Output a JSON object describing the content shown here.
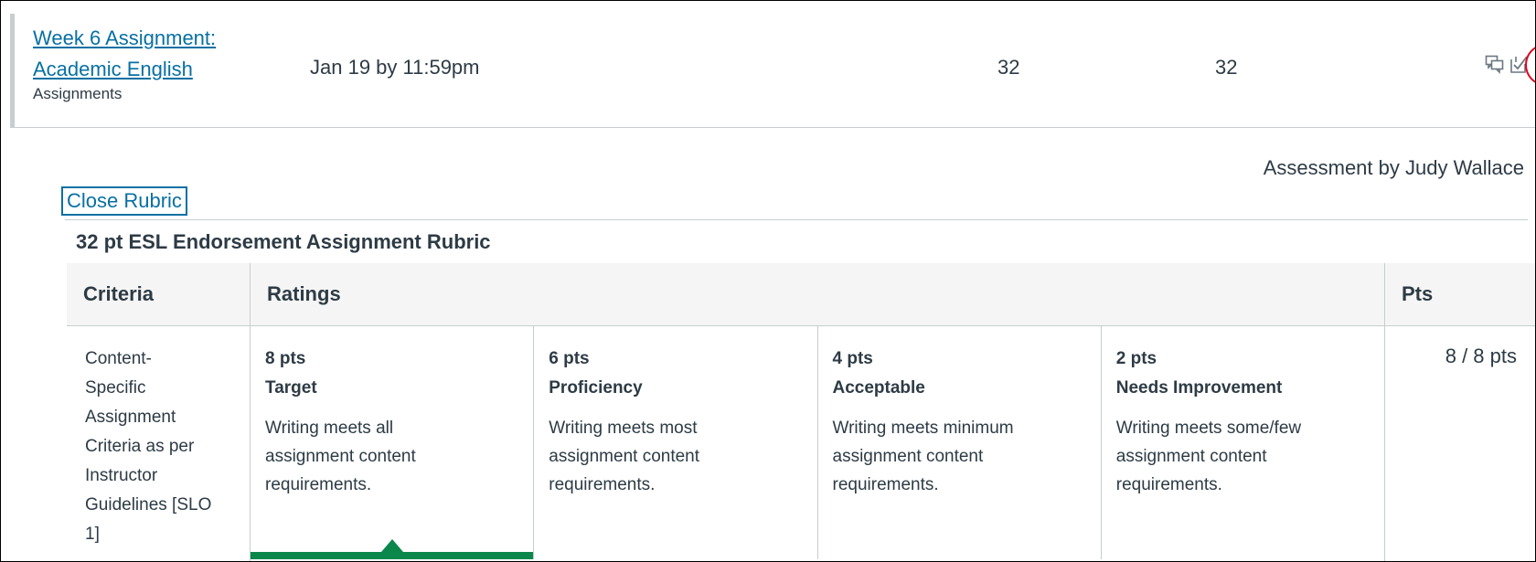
{
  "assignment": {
    "title_line1": "Week 6 Assignment:",
    "title_line2": "Academic English",
    "category": "Assignments",
    "due": "Jan 19 by 11:59pm",
    "score": "32",
    "out_of": "32",
    "icons": [
      "comment-icon",
      "muted-check-icon",
      "rubric-icon"
    ]
  },
  "assessment": {
    "by_text": "Assessment by Judy Wallace",
    "close_label": "Close Rubric",
    "rubric_title": "32 pt ESL Endorsement Assignment Rubric"
  },
  "table": {
    "headers": {
      "criteria": "Criteria",
      "ratings": "Ratings",
      "pts": "Pts"
    },
    "criterion": "Content-Specific Assignment Criteria as per Instructor Guidelines [SLO 1]",
    "criterion_lines": [
      "Content-",
      "Specific",
      "Assignment",
      "Criteria as per",
      "Instructor",
      "Guidelines [SLO",
      "1]"
    ],
    "ratings": [
      {
        "pts": "8 pts",
        "name": "Target",
        "desc": "Writing meets all assignment content requirements.",
        "selected": true
      },
      {
        "pts": "6 pts",
        "name": "Proficiency",
        "desc": "Writing meets most assignment content requirements.",
        "selected": false
      },
      {
        "pts": "4 pts",
        "name": "Acceptable",
        "desc": "Writing meets minimum assignment content requirements.",
        "selected": false
      },
      {
        "pts": "2 pts",
        "name": "Needs Improvement",
        "desc": "Writing meets some/few assignment content requirements.",
        "selected": false
      }
    ],
    "points": "8 / 8 pts"
  },
  "colors": {
    "link": "#0770a3",
    "selected": "#0b874b",
    "highlight_circle": "#e0001b"
  }
}
